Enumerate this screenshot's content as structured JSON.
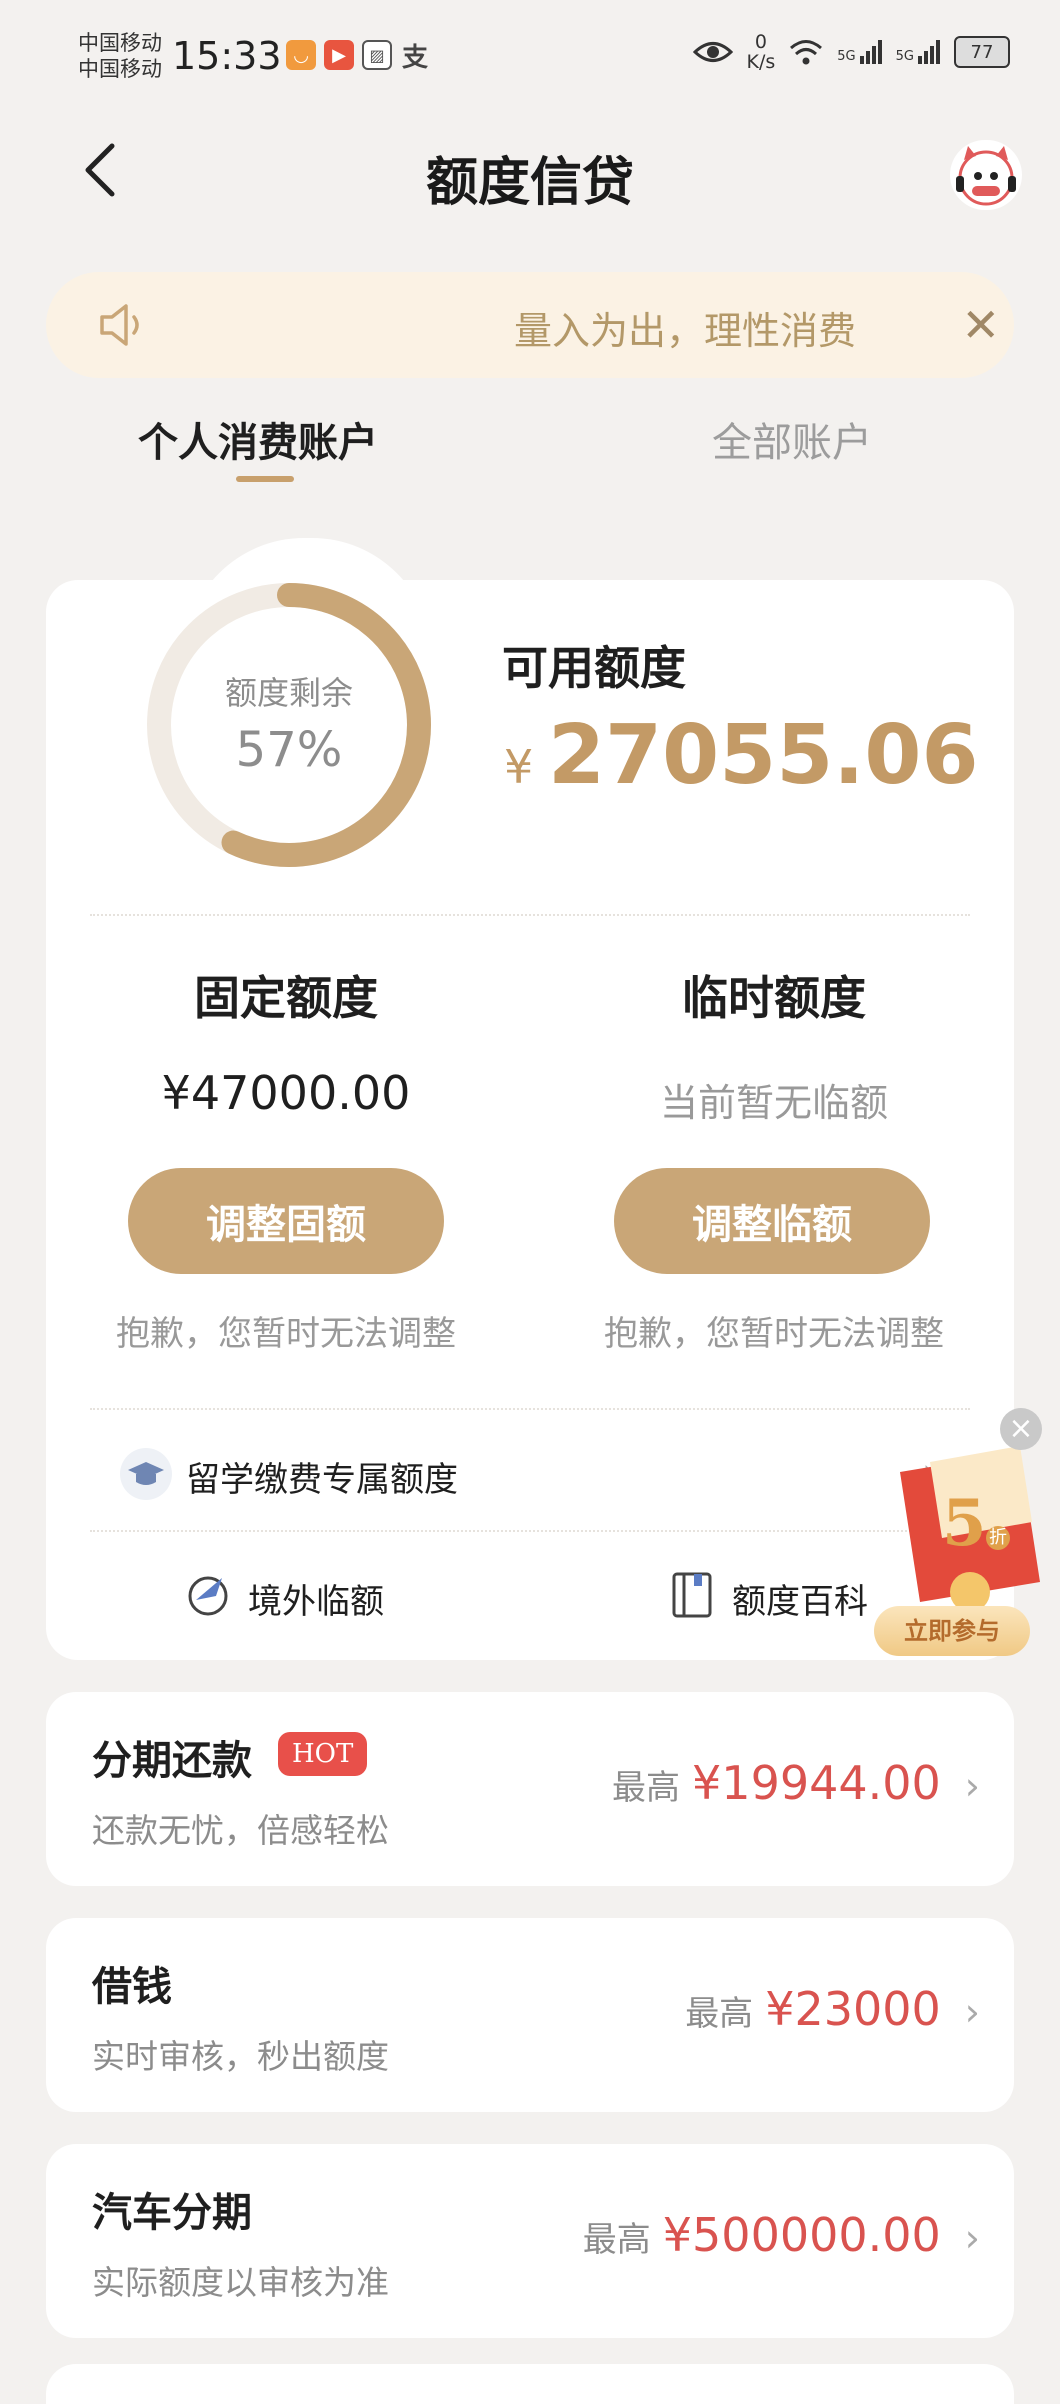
{
  "status_bar": {
    "carrier1": "中国移动",
    "carrier2": "中国移动",
    "time": "15:33",
    "net_speed_value": "0",
    "net_speed_unit": "K/s",
    "signal1": "5G",
    "signal2": "5G",
    "battery": "77"
  },
  "header": {
    "title": "额度信贷"
  },
  "notice": {
    "text": "量入为出，理性消费"
  },
  "tabs": [
    {
      "label": "个人消费账户",
      "active": true
    },
    {
      "label": "全部账户",
      "active": false
    }
  ],
  "quota": {
    "ring_label": "额度剩余",
    "ring_percent_text": "57%",
    "ring_fraction": 0.57,
    "available_label": "可用额度",
    "currency": "¥",
    "available_amount": "27055.06",
    "fixed": {
      "title": "固定额度",
      "value": "¥47000.00",
      "button": "调整固额",
      "note": "抱歉，您暂时无法调整"
    },
    "temp": {
      "title": "临时额度",
      "value": "当前暂无临额",
      "button": "调整临额",
      "note": "抱歉，您暂时无法调整"
    },
    "study_row": "留学缴费专属额度",
    "links": [
      {
        "label": "境外临额",
        "icon": "plane-icon"
      },
      {
        "label": "额度百科",
        "icon": "book-icon"
      }
    ]
  },
  "promo": {
    "badge": "5",
    "badge_suffix": "折",
    "button": "立即参与"
  },
  "products": [
    {
      "title": "分期还款",
      "badge": "HOT",
      "subtitle": "还款无忧，倍感轻松",
      "prefix": "最高",
      "amount": "¥19944.00"
    },
    {
      "title": "借钱",
      "subtitle": "实时审核，秒出额度",
      "prefix": "最高",
      "amount": "¥23000"
    },
    {
      "title": "汽车分期",
      "subtitle": "实际额度以审核为准",
      "prefix": "最高",
      "amount": "¥500000.00"
    }
  ],
  "colors": {
    "accent": "#c39a66",
    "button": "#c9a677",
    "price_red": "#d9534f",
    "background": "#f3f1ef"
  }
}
